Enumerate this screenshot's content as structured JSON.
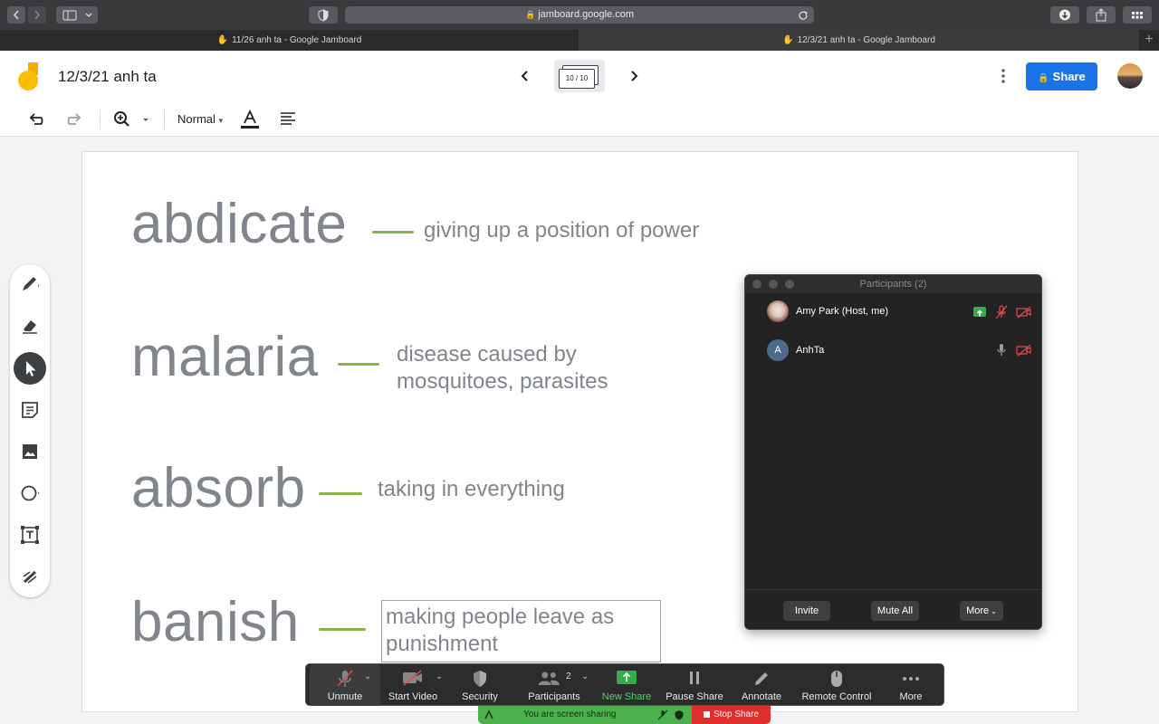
{
  "browser": {
    "url": "jamboard.google.com",
    "tabs": [
      {
        "title": "11/26 anh ta - Google Jamboard",
        "active": false
      },
      {
        "title": "12/3/21 anh ta - Google Jamboard",
        "active": true
      }
    ]
  },
  "jamboard": {
    "title": "12/3/21 anh ta",
    "frame_counter": "10 / 10",
    "share_label": "Share",
    "text_style": "Normal",
    "colors": {
      "brand_blue": "#1a73e8",
      "logo_orange": "#f9ab00",
      "logo_yellow": "#fbbc04"
    }
  },
  "board": {
    "entries": [
      {
        "term": "abdicate",
        "definition": [
          "giving up a position of power"
        ]
      },
      {
        "term": "malaria",
        "definition": [
          "disease caused by",
          "mosquitoes, parasites"
        ]
      },
      {
        "term": "absorb",
        "definition": [
          "taking in everything"
        ]
      },
      {
        "term": "banish",
        "definition": [
          "making people leave as",
          "punishment"
        ]
      }
    ]
  },
  "tools": [
    "pen-icon",
    "eraser-icon",
    "select-icon",
    "sticky-note-icon",
    "image-icon",
    "circle-icon",
    "text-box-icon",
    "laser-icon"
  ],
  "participants": {
    "title": "Participants (2)",
    "list": [
      {
        "name": "Amy Park (Host, me)",
        "initial": ""
      },
      {
        "name": "AnhTa",
        "initial": "A"
      }
    ],
    "buttons": {
      "invite": "Invite",
      "mute_all": "Mute All",
      "more": "More"
    }
  },
  "zoom": {
    "unmute": "Unmute",
    "start_video": "Start Video",
    "security": "Security",
    "participants": "Participants",
    "participants_count": "2",
    "new_share": "New Share",
    "pause_share": "Pause Share",
    "annotate": "Annotate",
    "remote_control": "Remote Control",
    "more": "More",
    "sharing_status": "You are screen sharing",
    "stop_share": "Stop Share",
    "colors": {
      "share_green": "#4cb14c",
      "stop_red": "#e02d2d"
    }
  }
}
